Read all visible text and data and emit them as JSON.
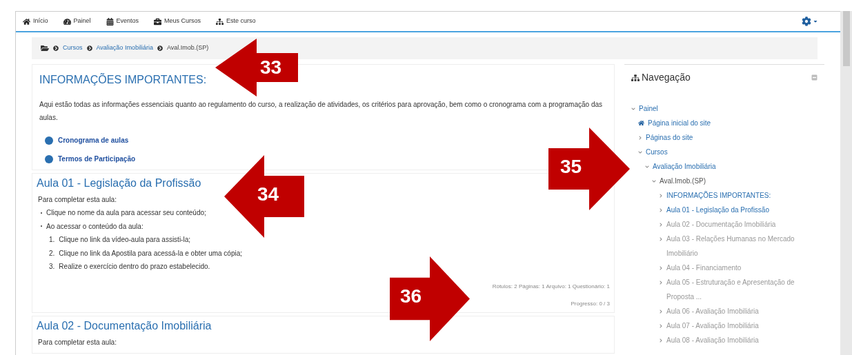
{
  "navbar": {
    "items": [
      {
        "label": "Início",
        "kind": "home"
      },
      {
        "label": "Painel",
        "kind": "dashboard"
      },
      {
        "label": "Eventos",
        "kind": "calendar"
      },
      {
        "label": "Meus Cursos",
        "kind": "briefcase"
      },
      {
        "label": "Este curso",
        "kind": "sitemap"
      }
    ]
  },
  "breadcrumb": [
    {
      "label": "Cursos",
      "kind": "link"
    },
    {
      "label": "Avaliação Imobiliária",
      "kind": "link"
    },
    {
      "label": "Aval.Imob.(SP)",
      "kind": "current"
    }
  ],
  "sections": [
    {
      "title": "INFORMAÇÕES IMPORTANTES:",
      "kind": "info",
      "paragraph": "Aqui estão todas as informações essenciais quanto ao regulamento do curso, a realização de atividades, os critérios para aprovação, bem como o cronograma com a programação das aulas.",
      "resources": [
        "Cronograma de aulas",
        "Termos de Participação"
      ]
    },
    {
      "title": "Aula 01 - Legislação da Profissão",
      "kind": "lesson",
      "intro": "Para completar esta aula:",
      "bullets": [
        "Clique no nome da aula para acessar seu conteúdo;",
        "Ao acessar o conteúdo da aula:"
      ],
      "steps": [
        {
          "number": "1.",
          "text": "Clique no link da vídeo-aula para assisti-la;"
        },
        {
          "number": "2.",
          "text": "Clique no link da Apostila para acessá-la e obter uma cópia;"
        },
        {
          "number": "3.",
          "text": "Realize o exercício dentro do prazo estabelecido."
        }
      ],
      "summary": "Rótulos: 2 Páginas: 1 Arquivo: 1 Questionário: 1",
      "progress": "Progresso: 0 / 3"
    },
    {
      "title": "Aula 02 - Documentação Imobiliária",
      "kind": "lesson",
      "intro": "Para completar esta aula:"
    }
  ],
  "navigation": {
    "title": "Navegação",
    "tree": [
      {
        "label": "Painel",
        "kind": "branch",
        "expanded": true,
        "children": [
          {
            "label": "Página inicial do site",
            "kind": "home"
          },
          {
            "label": "Páginas do site",
            "kind": "branch",
            "expanded": false
          },
          {
            "label": "Cursos",
            "kind": "branch",
            "expanded": true,
            "children": [
              {
                "label": "Avaliação Imobiliária",
                "kind": "branch",
                "expanded": true,
                "children": [
                  {
                    "label": "Aval.Imob.(SP)",
                    "kind": "current",
                    "expanded": true,
                    "children": [
                      {
                        "label": "INFORMAÇÕES IMPORTANTES:",
                        "kind": "branch",
                        "expanded": false,
                        "dimmed": false
                      },
                      {
                        "label": "Aula 01 - Legislação da Profissão",
                        "kind": "branch",
                        "expanded": false,
                        "dimmed": false
                      },
                      {
                        "label": "Aula 02 - Documentação Imobiliária",
                        "kind": "branch",
                        "expanded": false,
                        "dimmed": true
                      },
                      {
                        "label": "Aula 03 - Relações Humanas no Mercado Imobiliário",
                        "kind": "branch",
                        "expanded": false,
                        "dimmed": true
                      },
                      {
                        "label": "Aula 04 - Financiamento",
                        "kind": "branch",
                        "expanded": false,
                        "dimmed": true
                      },
                      {
                        "label": "Aula 05 - Estruturação e Apresentação de Proposta ...",
                        "kind": "branch",
                        "expanded": false,
                        "dimmed": true
                      },
                      {
                        "label": "Aula 06 - Avaliação Imobiliária",
                        "kind": "branch",
                        "expanded": false,
                        "dimmed": true
                      },
                      {
                        "label": "Aula 07 - Avaliação Imobiliária",
                        "kind": "branch",
                        "expanded": false,
                        "dimmed": true
                      },
                      {
                        "label": "Aula 08 - Avaliação Imobiliária",
                        "kind": "branch",
                        "expanded": false,
                        "dimmed": true
                      }
                    ]
                  }
                ]
              }
            ]
          }
        ]
      }
    ]
  },
  "callouts": [
    {
      "number": "33",
      "kind": "left"
    },
    {
      "number": "34",
      "kind": "left"
    },
    {
      "number": "35",
      "kind": "right"
    },
    {
      "number": "36",
      "kind": "right"
    }
  ]
}
